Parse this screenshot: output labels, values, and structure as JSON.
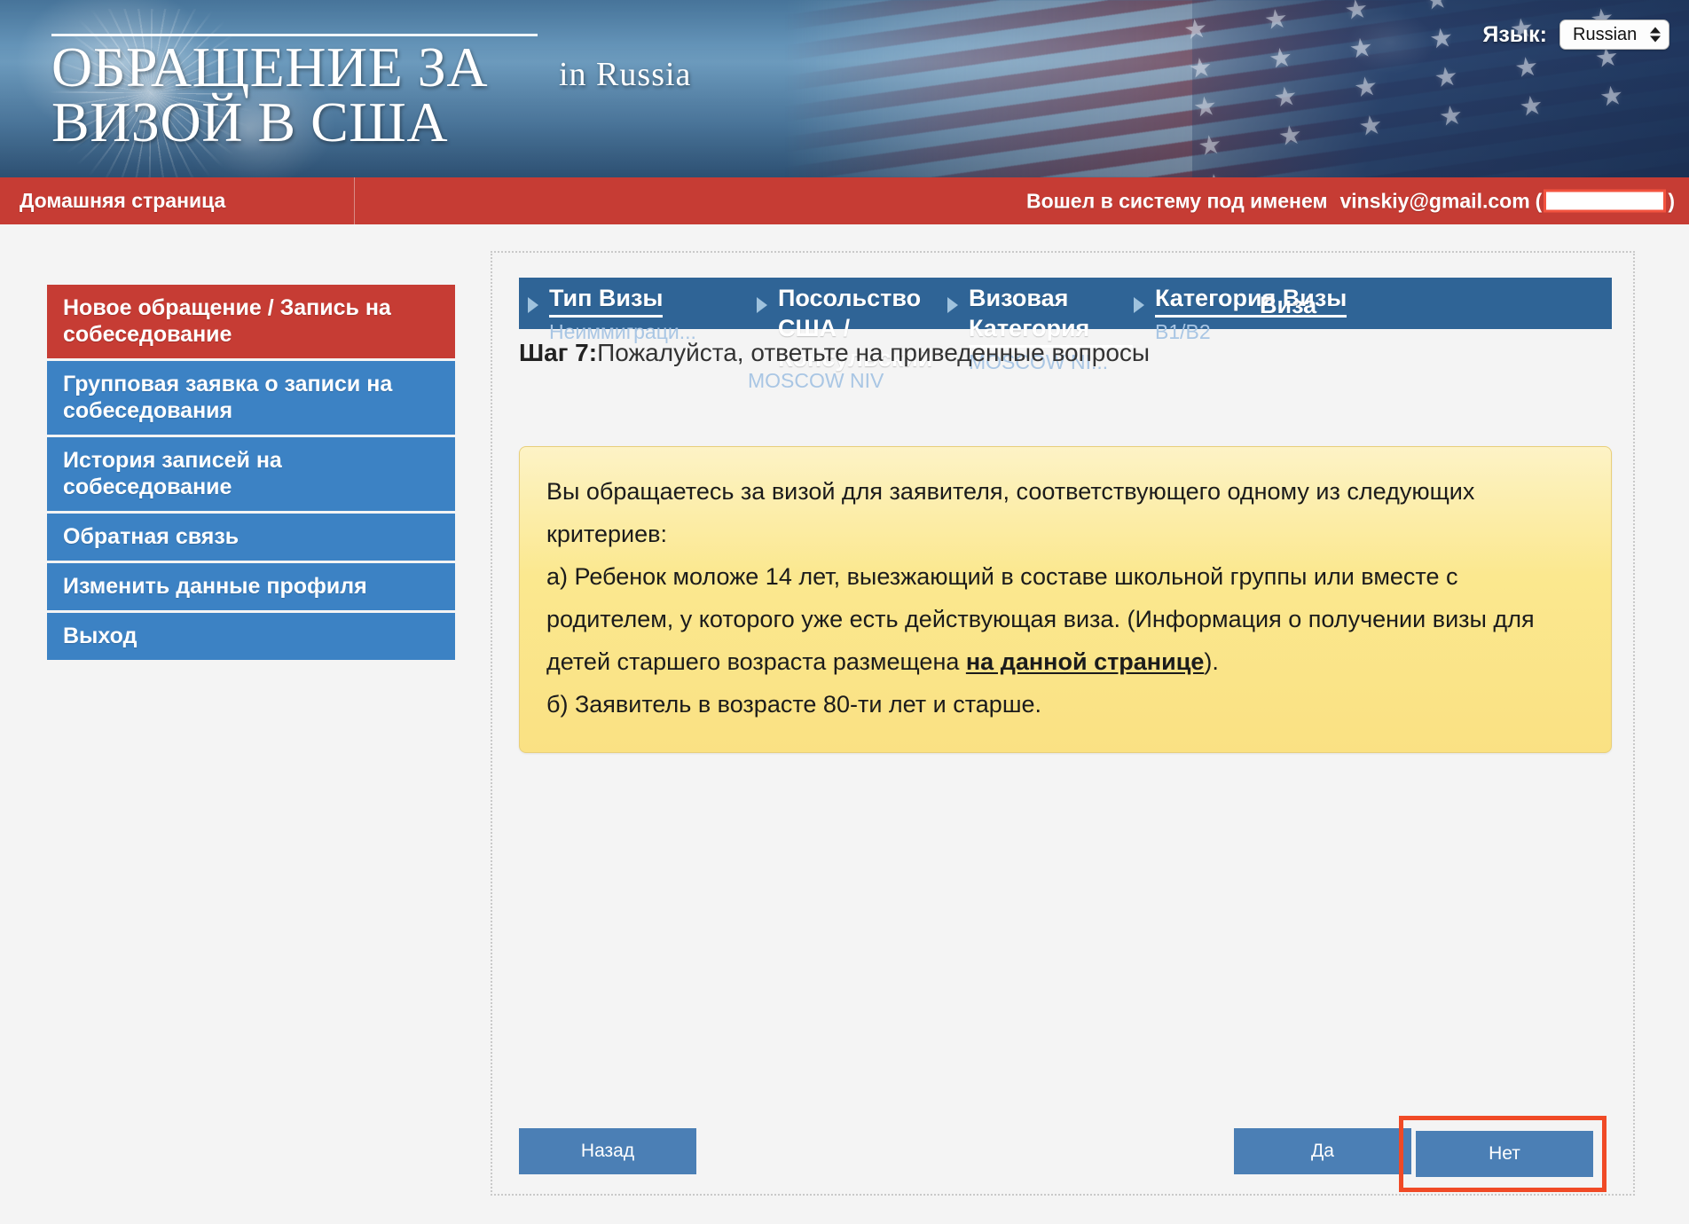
{
  "header": {
    "title_line1": "ОБРАЩЕНИЕ ЗА",
    "title_line2": "ВИЗОЙ В США",
    "title": "ОБРАЩЕНИЕ ЗА\nВИЗОЙ В США",
    "subtitle": "in  Russia",
    "language_label": "Язык:",
    "language_value": "Russian"
  },
  "navbar": {
    "home_label": "Домашняя страница",
    "logged_in_prefix": "Вошел в систему под именем",
    "logged_in_email": "vinskiy@gmail.com",
    "paren_open": "(",
    "paren_close": ")"
  },
  "sidebar": {
    "items": [
      {
        "label": "Новое обращение / Запись на собеседование",
        "active": true
      },
      {
        "label": "Групповая заявка о записи на собеседования",
        "active": false
      },
      {
        "label": "История записей на собеседование",
        "active": false
      },
      {
        "label": "Обратная связь",
        "active": false
      },
      {
        "label": "Изменить данные профиля",
        "active": false
      },
      {
        "label": "Выход",
        "active": false
      }
    ]
  },
  "breadcrumb": {
    "steps": [
      {
        "title": "Тип Визы",
        "value": "Неиммиграци..."
      },
      {
        "title": "Посольство США / Консульский",
        "value": ""
      },
      {
        "title": "Визовая Категория",
        "value": "MOSCOW NI..."
      },
      {
        "title": "Категория Визы",
        "value": "B1/B2"
      },
      {
        "title": "Виза",
        "value": "MOSCOW NIV"
      }
    ]
  },
  "step": {
    "label": "Шаг 7",
    "separator": ":",
    "text": "Пожалуйста, ответьте на приведенные вопросы",
    "overflow_value": "MOSCOW NIV"
  },
  "notice": {
    "line1": "Вы обращаетесь за визой для заявителя, соответствующего одному из следующих критериев:",
    "line2_a": "а) Ребенок моложе 14 лет, выезжающий в составе школьной группы или вместе с родителем, у которого уже есть действующая виза. (Информация о получении визы для детей старшего возраста размещена ",
    "link_text": "на данной странице",
    "line2_end": ").",
    "line3_b": "б) Заявитель в возрасте 80-ти лет и старше."
  },
  "buttons": {
    "back": "Назад",
    "yes": "Да",
    "no": "Нет"
  },
  "colors": {
    "red": "#c63c34",
    "blue": "#3c82c4",
    "crumb_blue": "#2f6496",
    "button_blue": "#4b7fb5",
    "notice_yellow": "#fae183",
    "highlight_orange": "#f04a26"
  }
}
